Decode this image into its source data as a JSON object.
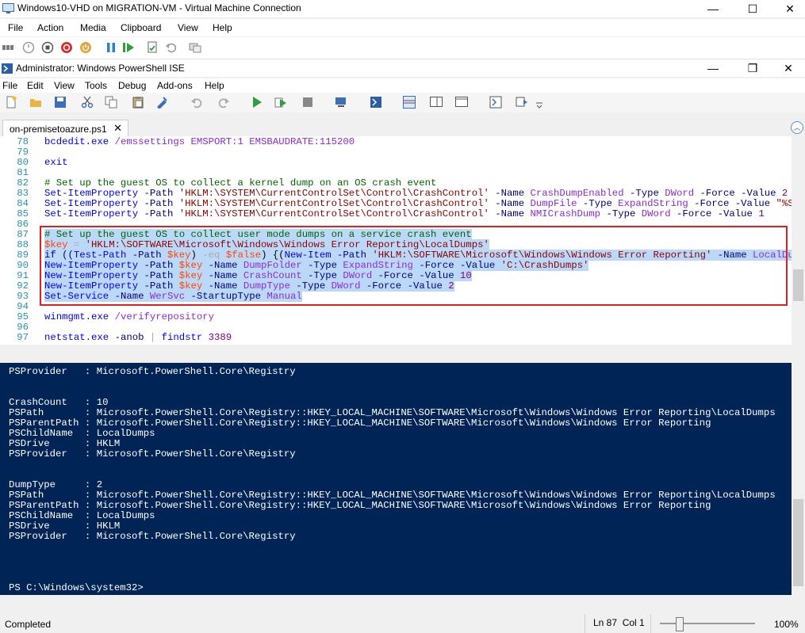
{
  "vm_window": {
    "title": "Windows10-VHD on MIGRATION-VM - Virtual Machine Connection",
    "menu": [
      "File",
      "Action",
      "Media",
      "Clipboard",
      "View",
      "Help"
    ],
    "controls": {
      "minimize": "—",
      "maximize": "☐",
      "close": "✕"
    }
  },
  "ise": {
    "title": "Administrator: Windows PowerShell ISE",
    "menu": [
      "File",
      "Edit",
      "View",
      "Tools",
      "Debug",
      "Add-ons",
      "Help"
    ],
    "controls": {
      "minimize": "—",
      "restore": "❐",
      "close": "✕"
    },
    "tab": {
      "label": "on-premisetoazure.ps1",
      "close": "✕"
    },
    "collapse_icon": "︿"
  },
  "script": {
    "lines": [
      {
        "n": "78",
        "top": 0
      },
      {
        "n": "79"
      },
      {
        "n": "80"
      },
      {
        "n": "81"
      },
      {
        "n": "82"
      },
      {
        "n": "83"
      },
      {
        "n": "84"
      },
      {
        "n": "85"
      },
      {
        "n": "86"
      },
      {
        "n": "87"
      },
      {
        "n": "88"
      },
      {
        "n": "89"
      },
      {
        "n": "90"
      },
      {
        "n": "91"
      },
      {
        "n": "92"
      },
      {
        "n": "93"
      },
      {
        "n": "94"
      },
      {
        "n": "95"
      },
      {
        "n": "96"
      },
      {
        "n": "97"
      }
    ],
    "code": {
      "l78": [
        "bcdedit.exe",
        " /emssettings",
        " EMSPORT:1 EMSBAUDRATE:115200"
      ],
      "l80": "exit",
      "l82": "# Set up the guest OS to collect a kernel dump on an OS crash event",
      "l83": [
        "Set-ItemProperty",
        " -Path ",
        "'HKLM:\\SYSTEM\\CurrentControlSet\\Control\\CrashControl'",
        " -Name ",
        "CrashDumpEnabled",
        " -Type ",
        "DWord",
        " -Force",
        " -Value ",
        "2"
      ],
      "l84": [
        "Set-ItemProperty",
        " -Path ",
        "'HKLM:\\SYSTEM\\CurrentControlSet\\Control\\CrashControl'",
        " -Name ",
        "DumpFile",
        " -Type ",
        "ExpandString",
        " -Force",
        " -Value ",
        "\"%Syst"
      ],
      "l85": [
        "Set-ItemProperty",
        " -Path ",
        "'HKLM:\\SYSTEM\\CurrentControlSet\\Control\\CrashControl'",
        " -Name ",
        "NMICrashDump",
        " -Type ",
        "DWord",
        " -Force",
        " -Value ",
        "1"
      ],
      "l87": "# Set up the guest OS to collect user mode dumps on a service crash event",
      "l88": [
        "$key",
        " = ",
        "'HKLM:\\SOFTWARE\\Microsoft\\Windows\\Windows Error Reporting\\LocalDumps'"
      ],
      "l89": [
        "if ((",
        "Test-Path",
        " -Path ",
        "$key",
        ") ",
        "-eq",
        " ",
        "$false",
        ") {(",
        "New-Item",
        " -Path ",
        "'HKLM:\\SOFTWARE\\Microsoft\\Windows\\Windows Error Reporting'",
        " -Name ",
        "LocalDumps"
      ],
      "l90": [
        "New-ItemProperty",
        " -Path ",
        "$key",
        " -Name ",
        "DumpFolder",
        " -Type ",
        "ExpandString",
        " -Force",
        " -Value ",
        "'C:\\CrashDumps'"
      ],
      "l91": [
        "New-ItemProperty",
        " -Path ",
        "$key",
        " -Name ",
        "CrashCount",
        " -Type ",
        "DWord",
        " -Force",
        " -Value ",
        "10"
      ],
      "l92": [
        "New-ItemProperty",
        " -Path ",
        "$key",
        " -Name ",
        "DumpType",
        " -Type ",
        "DWord",
        " -Force",
        " -Value ",
        "2"
      ],
      "l93": [
        "Set-Service",
        " -Name ",
        "WerSvc",
        " -StartupType ",
        "Manual"
      ],
      "l95": [
        "winmgmt.exe",
        " /verifyrepository"
      ],
      "l97": [
        "netstat.exe",
        " -anob",
        " | ",
        "findstr",
        " 3389"
      ]
    }
  },
  "console": {
    "lines": [
      "PSProvider   : Microsoft.PowerShell.Core\\Registry",
      "",
      "",
      "CrashCount   : 10",
      "PSPath       : Microsoft.PowerShell.Core\\Registry::HKEY_LOCAL_MACHINE\\SOFTWARE\\Microsoft\\Windows\\Windows Error Reporting\\LocalDumps",
      "PSParentPath : Microsoft.PowerShell.Core\\Registry::HKEY_LOCAL_MACHINE\\SOFTWARE\\Microsoft\\Windows\\Windows Error Reporting",
      "PSChildName  : LocalDumps",
      "PSDrive      : HKLM",
      "PSProvider   : Microsoft.PowerShell.Core\\Registry",
      "",
      "",
      "DumpType     : 2",
      "PSPath       : Microsoft.PowerShell.Core\\Registry::HKEY_LOCAL_MACHINE\\SOFTWARE\\Microsoft\\Windows\\Windows Error Reporting\\LocalDumps",
      "PSParentPath : Microsoft.PowerShell.Core\\Registry::HKEY_LOCAL_MACHINE\\SOFTWARE\\Microsoft\\Windows\\Windows Error Reporting",
      "PSChildName  : LocalDumps",
      "PSDrive      : HKLM",
      "PSProvider   : Microsoft.PowerShell.Core\\Registry",
      "",
      "",
      "",
      "",
      "PS C:\\Windows\\system32>"
    ]
  },
  "status": {
    "text": "Completed",
    "position": "Ln 87  Col 1",
    "zoom": "100%",
    "zoom_level_fraction": 0.2
  }
}
